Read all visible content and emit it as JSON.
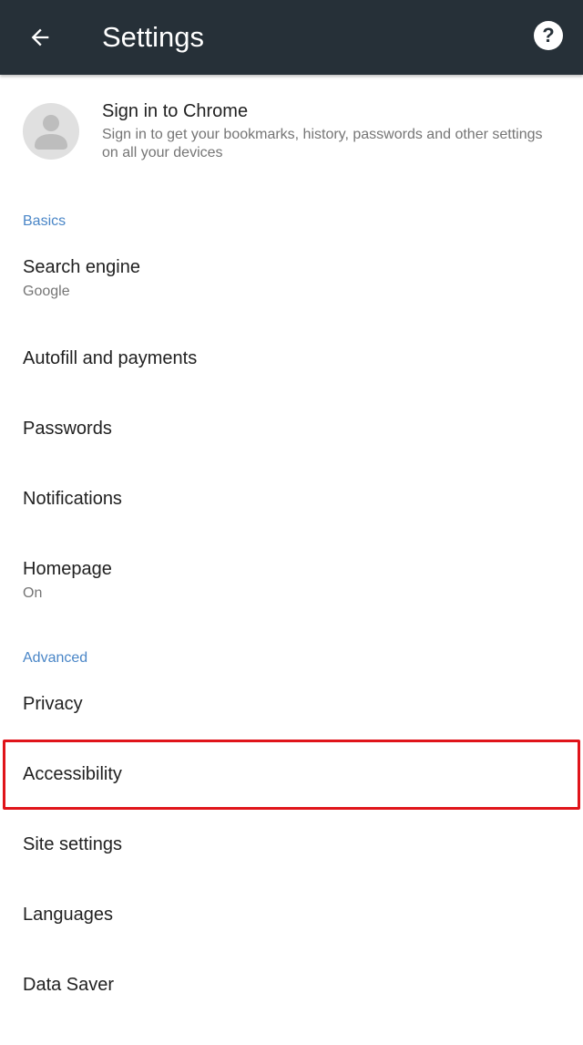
{
  "appbar": {
    "title": "Settings",
    "back_icon": "arrow-back-icon",
    "help_icon": "help-icon",
    "background": "#263038"
  },
  "account": {
    "title": "Sign in to Chrome",
    "subtitle": "Sign in to get your bookmarks, history, passwords and other settings on all your devices",
    "avatar_icon": "person-icon"
  },
  "sections": {
    "basics": "Basics",
    "advanced": "Advanced"
  },
  "basics_items": [
    {
      "label": "Search engine",
      "sub": "Google"
    },
    {
      "label": "Autofill and payments"
    },
    {
      "label": "Passwords"
    },
    {
      "label": "Notifications"
    },
    {
      "label": "Homepage",
      "sub": "On"
    }
  ],
  "advanced_items": [
    {
      "label": "Privacy"
    },
    {
      "label": "Accessibility"
    },
    {
      "label": "Site settings"
    },
    {
      "label": "Languages"
    },
    {
      "label": "Data Saver"
    }
  ],
  "colors": {
    "section_header": "#4a86c7",
    "highlight": "#e0141a"
  }
}
